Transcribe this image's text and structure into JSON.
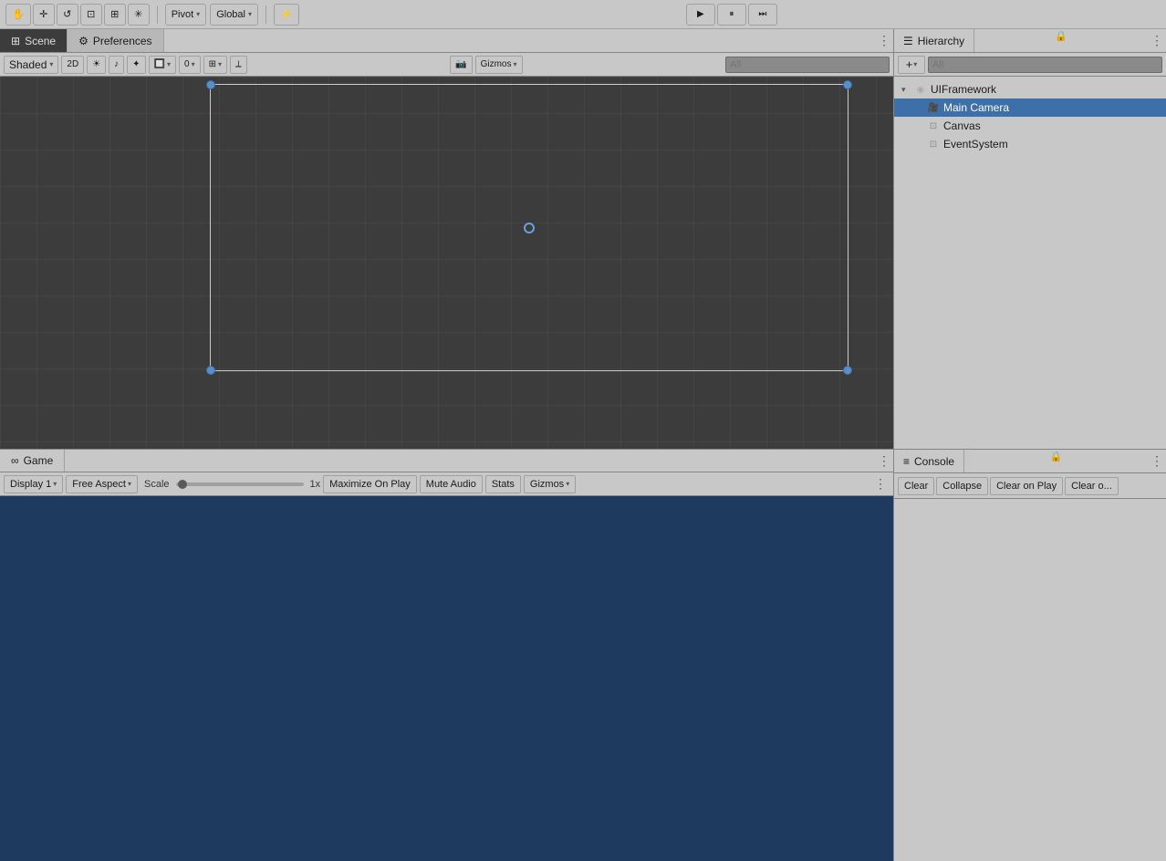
{
  "toolbar": {
    "tools": [
      {
        "name": "hand-tool",
        "icon": "✋",
        "label": "Hand"
      },
      {
        "name": "move-tool",
        "icon": "✛",
        "label": "Move"
      },
      {
        "name": "rotate-tool",
        "icon": "↺",
        "label": "Rotate"
      },
      {
        "name": "scale-tool",
        "icon": "⊡",
        "label": "Scale"
      },
      {
        "name": "rect-tool",
        "icon": "⊞",
        "label": "Rect"
      },
      {
        "name": "transform-tool",
        "icon": "✳",
        "label": "Transform"
      }
    ],
    "pivot_label": "Pivot",
    "global_label": "Global",
    "custom_tool_icon": "⚡"
  },
  "play_controls": {
    "play_icon": "▶",
    "pause_icon": "⏸",
    "step_icon": "⏭"
  },
  "scene": {
    "tab_label": "Scene",
    "tab_icon": "⊞",
    "shaded_label": "Shaded",
    "mode_2d": "2D",
    "gizmos_label": "Gizmos",
    "search_placeholder": "All",
    "viewport_dot_icon": "○"
  },
  "game": {
    "tab_label": "Game",
    "tab_icon": "∞",
    "display_label": "Display 1",
    "aspect_label": "Free Aspect",
    "scale_label": "Scale",
    "scale_value": "1x",
    "maximize_label": "Maximize On Play",
    "mute_label": "Mute Audio",
    "stats_label": "Stats",
    "gizmos_label": "Gizmos"
  },
  "hierarchy": {
    "panel_label": "Hierarchy",
    "panel_icon": "☰",
    "search_placeholder": "All",
    "items": [
      {
        "id": "uiframework",
        "label": "UIFramework",
        "indent": 0,
        "icon": "◉",
        "arrow": "▾",
        "selected": false
      },
      {
        "id": "main-camera",
        "label": "Main Camera",
        "indent": 1,
        "icon": "🎥",
        "arrow": "",
        "selected": true
      },
      {
        "id": "canvas",
        "label": "Canvas",
        "indent": 1,
        "icon": "⊡",
        "arrow": "",
        "selected": false
      },
      {
        "id": "eventsystem",
        "label": "EventSystem",
        "indent": 1,
        "icon": "⊡",
        "arrow": "",
        "selected": false
      }
    ]
  },
  "console": {
    "panel_label": "Console",
    "panel_icon": "≡",
    "buttons": [
      {
        "name": "clear-btn",
        "label": "Clear"
      },
      {
        "name": "collapse-btn",
        "label": "Collapse"
      },
      {
        "name": "clear-on-play-btn",
        "label": "Clear on Play"
      },
      {
        "name": "clear-on-build-btn",
        "label": "Clear o..."
      }
    ]
  },
  "colors": {
    "accent_blue": "#3d6fa8",
    "toolbar_bg": "#c8c8c8",
    "scene_bg": "#3c3c3c",
    "game_bg": "#1e3a5f",
    "panel_bg": "#c8c8c8"
  }
}
